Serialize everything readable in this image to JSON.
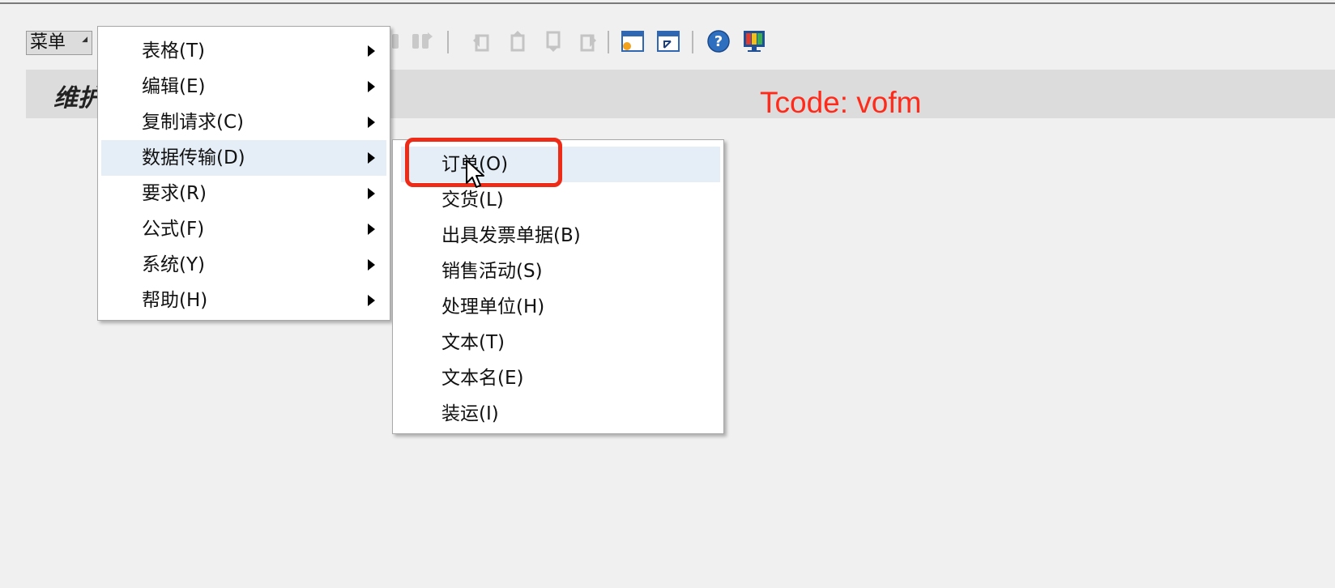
{
  "toolbar": {
    "menu_label": "菜单",
    "icons": [
      "table-icon",
      "find-icon",
      "find-next-icon",
      "first-page-icon",
      "prev-page-icon",
      "next-page-icon",
      "last-page-icon",
      "new-session-icon",
      "shortcut-icon",
      "help-icon",
      "customize-layout-icon"
    ]
  },
  "page": {
    "title": "维护"
  },
  "annotation": {
    "tcode": "Tcode: vofm",
    "color": "#ff2a1a"
  },
  "main_menu": {
    "items": [
      {
        "label": "表格(T)",
        "has_submenu": true
      },
      {
        "label": "编辑(E)",
        "has_submenu": true
      },
      {
        "label": "复制请求(C)",
        "has_submenu": true
      },
      {
        "label": "数据传输(D)",
        "has_submenu": true,
        "highlighted": true
      },
      {
        "label": "要求(R)",
        "has_submenu": true
      },
      {
        "label": "公式(F)",
        "has_submenu": true
      },
      {
        "label": "系统(Y)",
        "has_submenu": true
      },
      {
        "label": "帮助(H)",
        "has_submenu": true
      }
    ]
  },
  "sub_menu": {
    "items": [
      {
        "label": "订单(O)",
        "highlighted": true
      },
      {
        "label": "交货(L)"
      },
      {
        "label": "出具发票单据(B)"
      },
      {
        "label": "销售活动(S)"
      },
      {
        "label": "处理单位(H)"
      },
      {
        "label": "文本(T)"
      },
      {
        "label": "文本名(E)"
      },
      {
        "label": "装运(I)"
      }
    ]
  },
  "colors": {
    "highlight": "#e5eef7",
    "annotation_box": "#ee2b17"
  }
}
